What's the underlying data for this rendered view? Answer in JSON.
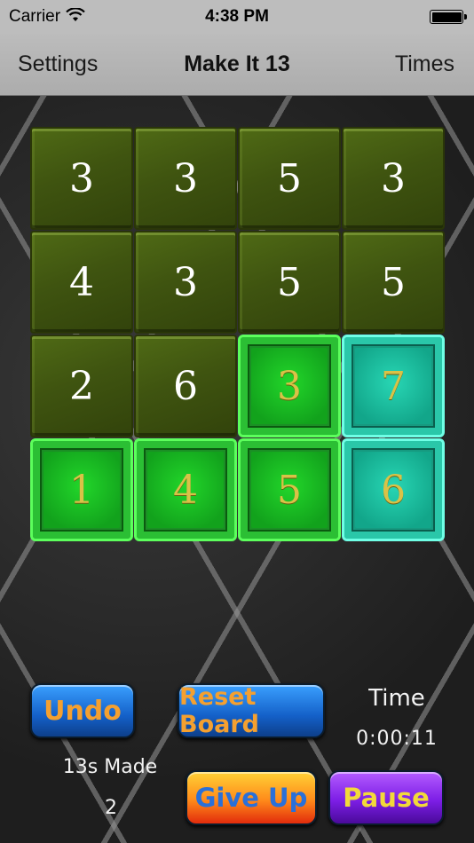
{
  "status_bar": {
    "carrier": "Carrier",
    "wifi_icon": "wifi-icon",
    "time": "4:38 PM",
    "battery_icon": "battery-icon"
  },
  "nav": {
    "left_button": "Settings",
    "title": "Make It 13",
    "right_button": "Times"
  },
  "board": {
    "tiles": [
      {
        "value": "3",
        "style": "olive"
      },
      {
        "value": "3",
        "style": "olive"
      },
      {
        "value": "5",
        "style": "olive"
      },
      {
        "value": "3",
        "style": "olive"
      },
      {
        "value": "4",
        "style": "olive"
      },
      {
        "value": "3",
        "style": "olive"
      },
      {
        "value": "5",
        "style": "olive"
      },
      {
        "value": "5",
        "style": "olive"
      },
      {
        "value": "2",
        "style": "olive"
      },
      {
        "value": "6",
        "style": "olive"
      },
      {
        "value": "3",
        "style": "green"
      },
      {
        "value": "7",
        "style": "teal"
      },
      {
        "value": "1",
        "style": "green"
      },
      {
        "value": "4",
        "style": "green"
      },
      {
        "value": "5",
        "style": "green"
      },
      {
        "value": "6",
        "style": "teal"
      }
    ]
  },
  "controls": {
    "undo": "Undo",
    "reset": "Reset Board",
    "give_up": "Give Up",
    "pause": "Pause"
  },
  "stats": {
    "time_label": "Time",
    "time_value": "0:00:11",
    "made_label": "13s Made",
    "made_value": "2"
  },
  "colors": {
    "olive_tile": "#3f5410",
    "green_tile": "#1b8f25",
    "teal_tile": "#169a80",
    "tile_text_dark": "#ffffff",
    "tile_text_gold": "#d9c247"
  }
}
